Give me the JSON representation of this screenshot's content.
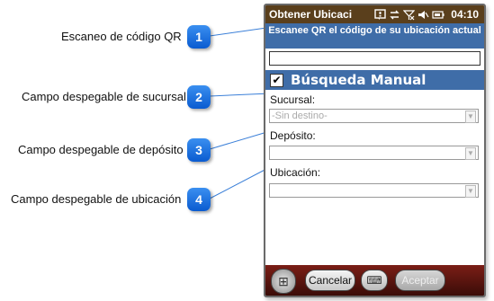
{
  "callouts": [
    {
      "number": "1",
      "label": "Escaneo de código QR"
    },
    {
      "number": "2",
      "label": "Campo despegable de sucursal"
    },
    {
      "number": "3",
      "label": "Campo despegable de depósito"
    },
    {
      "number": "4",
      "label": "Campo despegable de ubicación"
    }
  ],
  "status_bar": {
    "title": "Obtener Ubicaci",
    "time": "04:10",
    "icons": [
      "notification-icon",
      "sync-icon",
      "no-signal-icon",
      "volume-mute-icon",
      "battery-icon"
    ]
  },
  "qr": {
    "header": "Escanee QR el código de su ubicación actual",
    "value": ""
  },
  "manual": {
    "label": "Búsqueda Manual",
    "checked": true
  },
  "fields": {
    "sucursal_label": "Sucursal:",
    "sucursal_value": "-Sin destino-",
    "deposito_label": "Depósito:",
    "deposito_value": "",
    "ubicacion_label": "Ubicación:",
    "ubicacion_value": ""
  },
  "bottom_bar": {
    "cancel_label": "Cancelar",
    "accept_label": "Aceptar"
  },
  "colors": {
    "status_bar": "#5a3f1c",
    "header_blue": "#3f6da8",
    "bottom_bar": "#7b1e16",
    "badge_blue": "#1a6fe0"
  }
}
